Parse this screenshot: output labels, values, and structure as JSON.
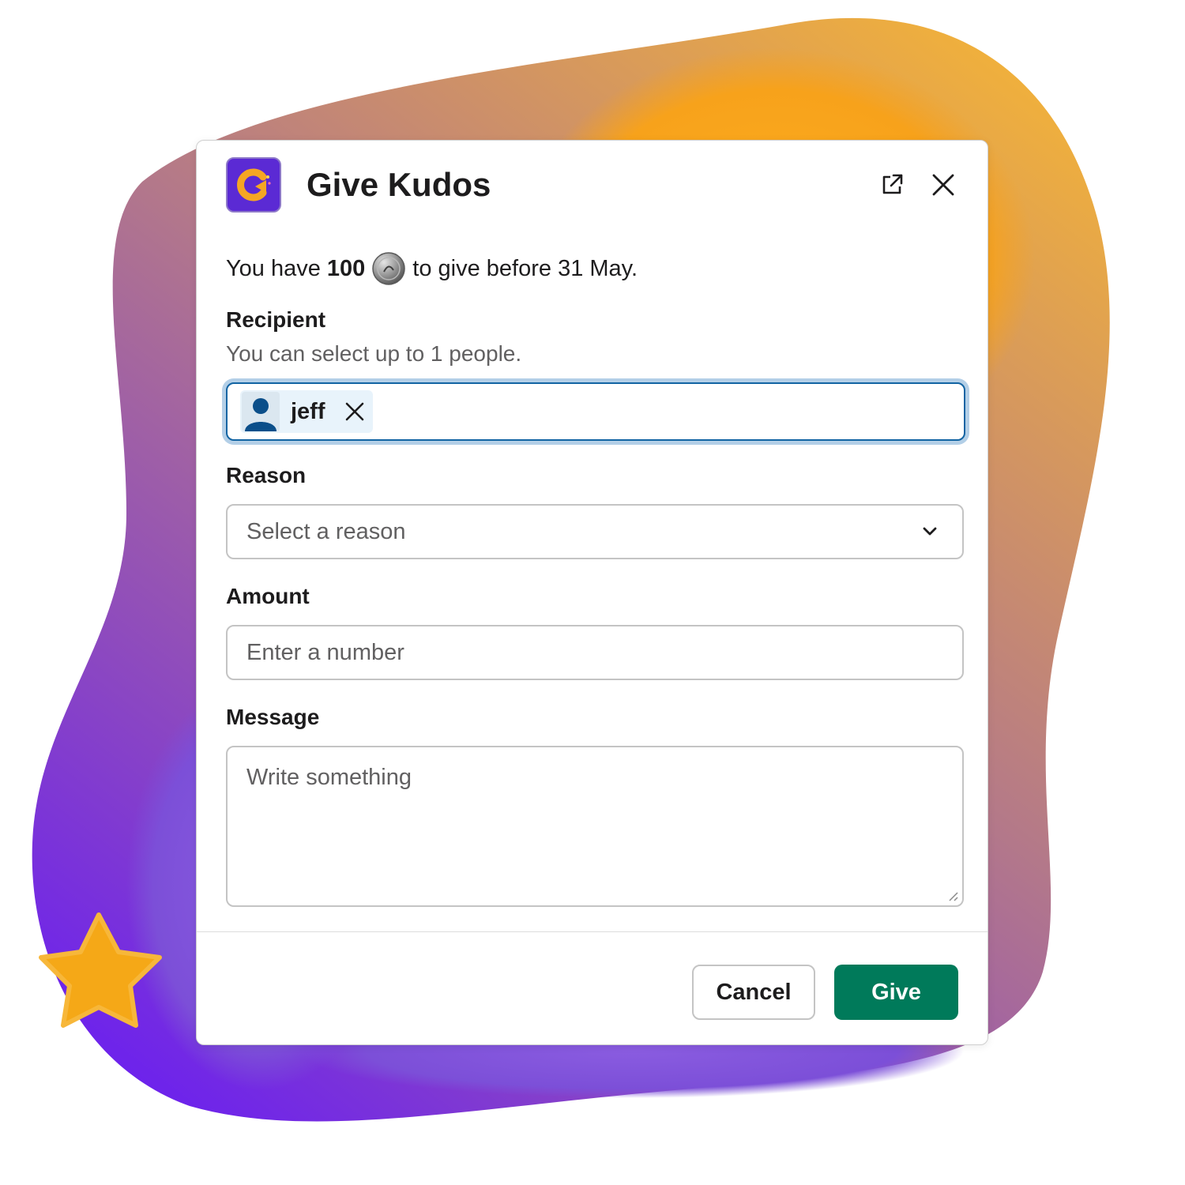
{
  "dialog": {
    "title": "Give Kudos",
    "icons": {
      "app": "kudos-app-icon",
      "open_external": "external-link-icon",
      "close": "close-icon"
    }
  },
  "balance": {
    "prefix": "You have",
    "amount": "100",
    "coin_icon": "coin-icon",
    "suffix": "to give before 31 May."
  },
  "recipient": {
    "label": "Recipient",
    "hint": "You can select up to 1 people.",
    "selected": [
      {
        "name": "jeff",
        "avatar_icon": "user-avatar-icon",
        "remove_icon": "remove-icon"
      }
    ]
  },
  "reason": {
    "label": "Reason",
    "placeholder": "Select a reason",
    "icon": "chevron-down-icon"
  },
  "amount": {
    "label": "Amount",
    "placeholder": "Enter a number"
  },
  "message": {
    "label": "Message",
    "placeholder": "Write something"
  },
  "actions": {
    "cancel_label": "Cancel",
    "give_label": "Give"
  },
  "colors": {
    "primary_button": "#007a5a",
    "focus_border": "#1264a3",
    "app_icon_bg": "#5b2ad4",
    "backdrop_top": "#f0b03c",
    "backdrop_bottom": "#6a1ff0"
  }
}
